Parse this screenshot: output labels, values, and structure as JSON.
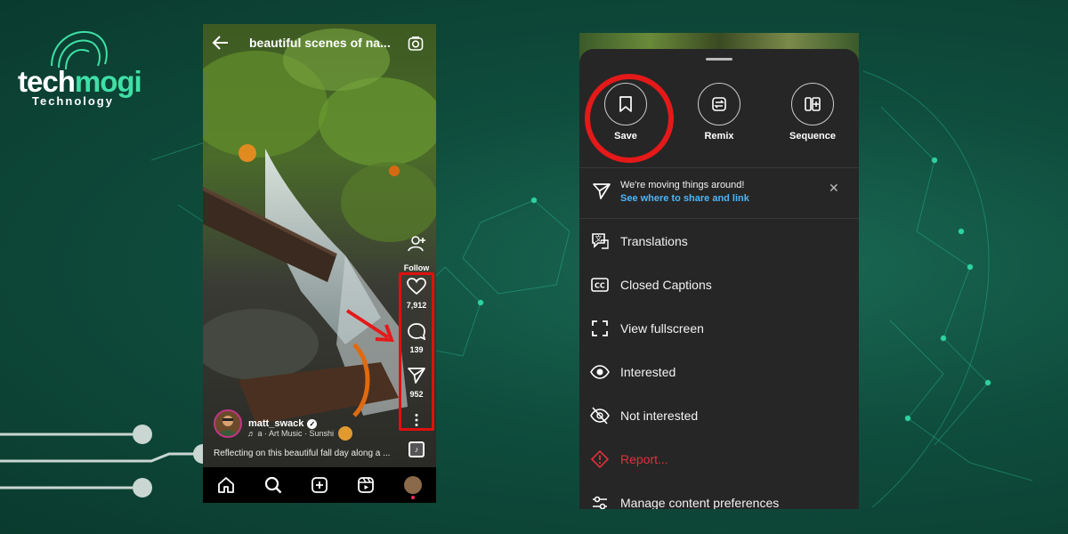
{
  "brand": {
    "name_a": "tech",
    "name_b": "mogi",
    "sub": "Technology"
  },
  "phone_left": {
    "video_title": "beautiful scenes of na...",
    "follow_label": "Follow",
    "likes": "7,912",
    "comments": "139",
    "shares": "952",
    "username": "matt_swack",
    "music_line": "♬ a · Art Music · Sunshi",
    "caption": "Reflecting on this beautiful fall day along a ...",
    "nav_icons": [
      "home-icon",
      "search-icon",
      "create-icon",
      "reels-icon",
      "profile-avatar"
    ]
  },
  "phone_right": {
    "top_actions": [
      {
        "label": "Save",
        "icon": "bookmark-icon"
      },
      {
        "label": "Remix",
        "icon": "remix-icon"
      },
      {
        "label": "Sequence",
        "icon": "sequence-icon"
      }
    ],
    "notice": {
      "title": "We're moving things around!",
      "link": "See where to share and link"
    },
    "menu": [
      {
        "label": "Translations",
        "icon": "translate-icon"
      },
      {
        "label": "Closed Captions",
        "icon": "cc-icon"
      },
      {
        "label": "View fullscreen",
        "icon": "fullscreen-icon"
      },
      {
        "label": "Interested",
        "icon": "eye-icon"
      },
      {
        "label": "Not interested",
        "icon": "eye-off-icon"
      },
      {
        "label": "Report...",
        "icon": "report-icon"
      },
      {
        "label": "Manage content preferences",
        "icon": "sliders-icon"
      }
    ]
  },
  "colors": {
    "accent_red": "#e51919",
    "link_blue": "#4cb5f9",
    "sheet_bg": "#262626",
    "brand_green": "#3fe0a6"
  }
}
